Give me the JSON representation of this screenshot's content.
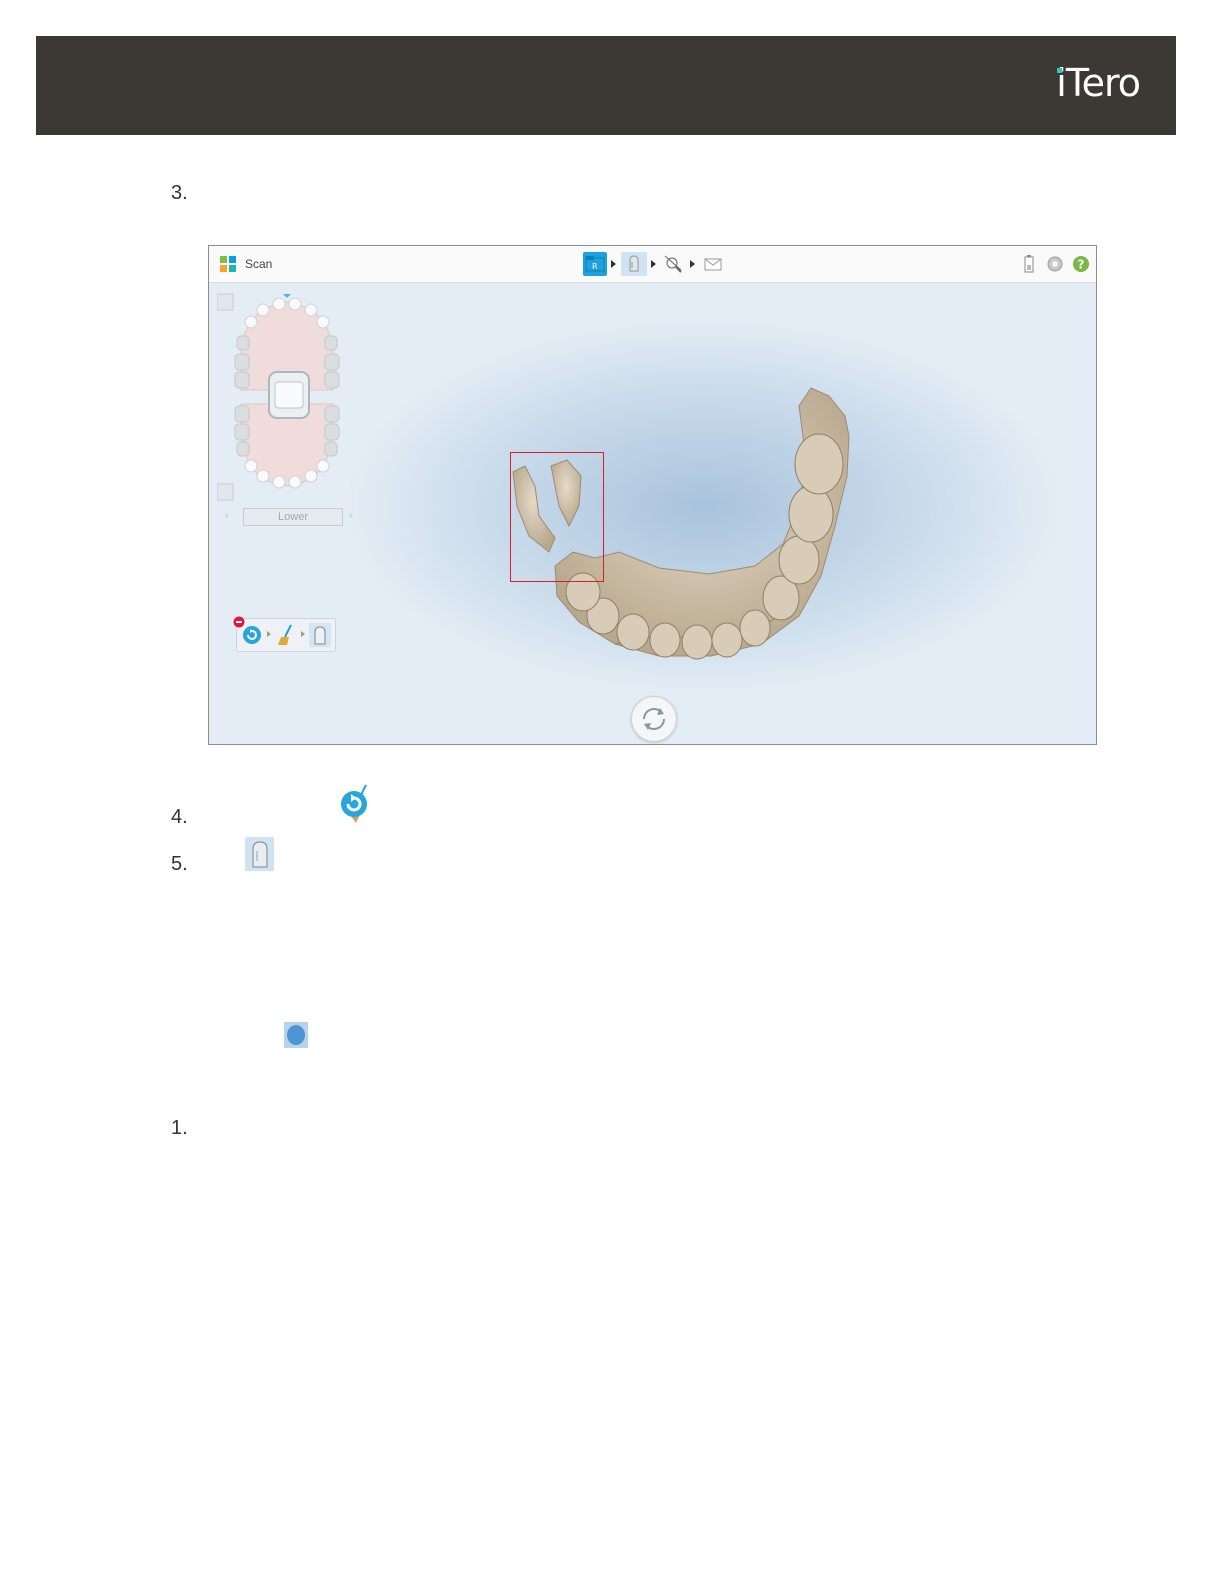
{
  "header": {
    "brand": "iTero",
    "brand_color": "#3c3833",
    "accent_color": "#2ec4b6"
  },
  "steps": {
    "step3": "3.",
    "step4": "4.",
    "step5": "5.",
    "step1": "1."
  },
  "screenshot": {
    "app_title": "Scan",
    "flow_icons": [
      "rx-folder-icon",
      "scan-icon",
      "view-tools-icon",
      "send-envelope-icon"
    ],
    "right_icons": [
      "battery-icon",
      "settings-gear-icon",
      "help-icon"
    ],
    "jaw_selector_label": "Lower",
    "tool_strip_icons": [
      "undo-remove-icon",
      "clean-brush-icon",
      "scan-tooth-icon"
    ],
    "highlight_color": "#d91f26"
  },
  "inline_icons": [
    "undo-tool-icon",
    "scan-tooth-icon",
    "eraser-blob-icon"
  ]
}
